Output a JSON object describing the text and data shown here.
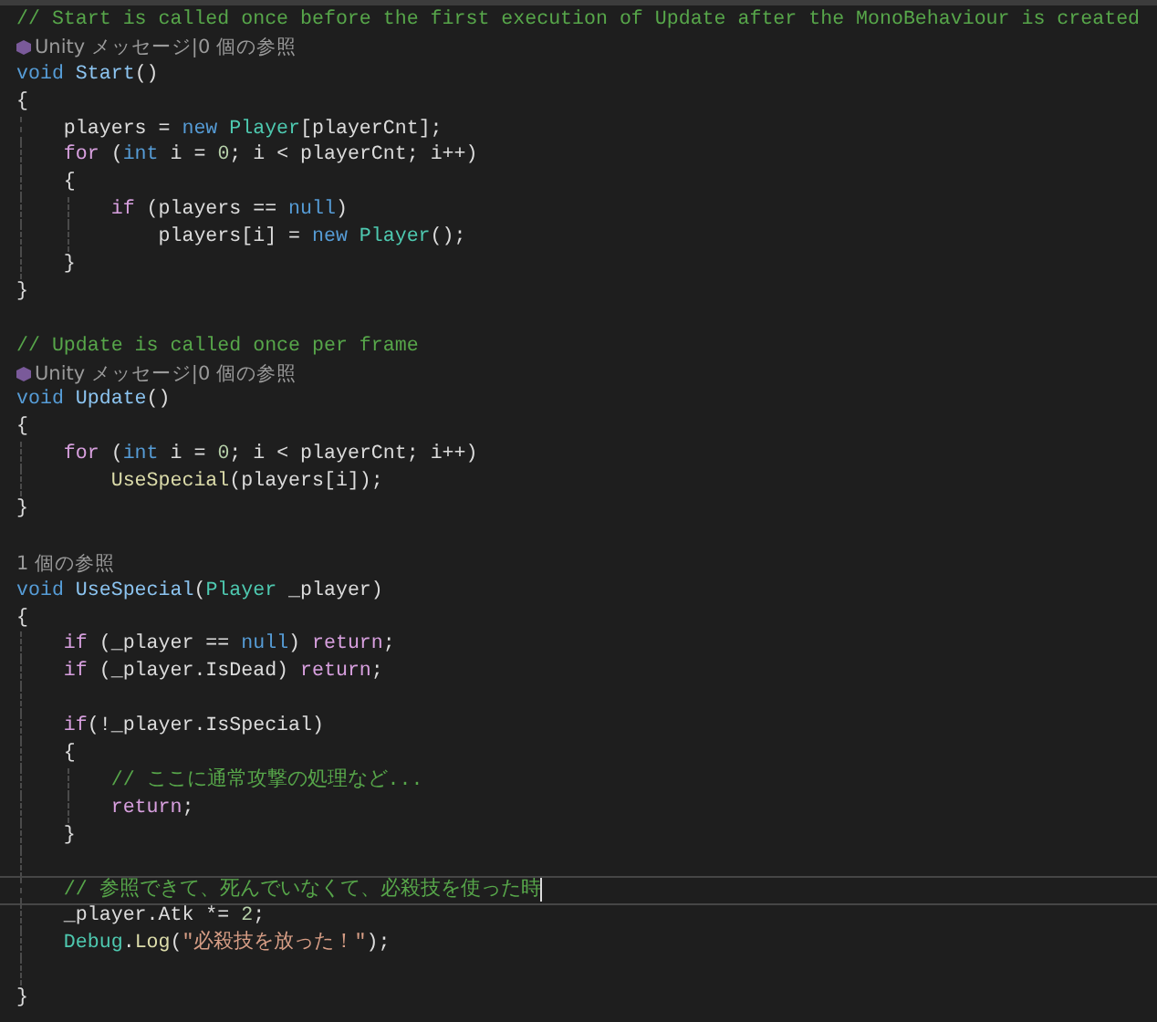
{
  "editor": {
    "lines": [
      {
        "kind": "code",
        "current": false,
        "tokens": [
          {
            "kind": "comment",
            "text": "// Start is called once before the first execution of Update after the MonoBehaviour is created"
          }
        ]
      },
      {
        "kind": "codelens",
        "icon": true,
        "text": "Unity メッセージ|0 個の参照"
      },
      {
        "kind": "code",
        "current": false,
        "tokens": [
          {
            "kind": "keyword",
            "text": "void "
          },
          {
            "kind": "decl",
            "text": "Start"
          },
          {
            "kind": "plain",
            "text": "()"
          }
        ]
      },
      {
        "kind": "code",
        "current": false,
        "tokens": [
          {
            "kind": "plain",
            "text": "{"
          }
        ]
      },
      {
        "kind": "code",
        "current": false,
        "tokens": [
          {
            "kind": "plain",
            "text": "    players = "
          },
          {
            "kind": "keyword",
            "text": "new "
          },
          {
            "kind": "class",
            "text": "Player"
          },
          {
            "kind": "plain",
            "text": "[playerCnt];"
          }
        ]
      },
      {
        "kind": "code",
        "current": false,
        "tokens": [
          {
            "kind": "control",
            "text": "    for"
          },
          {
            "kind": "plain",
            "text": " ("
          },
          {
            "kind": "keyword",
            "text": "int"
          },
          {
            "kind": "plain",
            "text": " i = "
          },
          {
            "kind": "number",
            "text": "0"
          },
          {
            "kind": "plain",
            "text": "; i < playerCnt; i++)"
          }
        ]
      },
      {
        "kind": "code",
        "current": false,
        "tokens": [
          {
            "kind": "plain",
            "text": "    {"
          }
        ]
      },
      {
        "kind": "code",
        "current": false,
        "tokens": [
          {
            "kind": "control",
            "text": "        if"
          },
          {
            "kind": "plain",
            "text": " (players == "
          },
          {
            "kind": "keyword",
            "text": "null"
          },
          {
            "kind": "plain",
            "text": ")"
          }
        ]
      },
      {
        "kind": "code",
        "current": false,
        "tokens": [
          {
            "kind": "plain",
            "text": "            players[i] = "
          },
          {
            "kind": "keyword",
            "text": "new "
          },
          {
            "kind": "class",
            "text": "Player"
          },
          {
            "kind": "plain",
            "text": "();"
          }
        ]
      },
      {
        "kind": "code",
        "current": false,
        "tokens": [
          {
            "kind": "plain",
            "text": "    }"
          }
        ]
      },
      {
        "kind": "code",
        "current": false,
        "tokens": [
          {
            "kind": "plain",
            "text": "}"
          }
        ]
      },
      {
        "kind": "blank",
        "current": false
      },
      {
        "kind": "code",
        "current": false,
        "tokens": [
          {
            "kind": "comment",
            "text": "// Update is called once per frame"
          }
        ]
      },
      {
        "kind": "codelens",
        "icon": true,
        "text": "Unity メッセージ|0 個の参照"
      },
      {
        "kind": "code",
        "current": false,
        "tokens": [
          {
            "kind": "keyword",
            "text": "void "
          },
          {
            "kind": "decl",
            "text": "Update"
          },
          {
            "kind": "plain",
            "text": "()"
          }
        ]
      },
      {
        "kind": "code",
        "current": false,
        "tokens": [
          {
            "kind": "plain",
            "text": "{"
          }
        ]
      },
      {
        "kind": "code",
        "current": false,
        "tokens": [
          {
            "kind": "control",
            "text": "    for"
          },
          {
            "kind": "plain",
            "text": " ("
          },
          {
            "kind": "keyword",
            "text": "int"
          },
          {
            "kind": "plain",
            "text": " i = "
          },
          {
            "kind": "number",
            "text": "0"
          },
          {
            "kind": "plain",
            "text": "; i < playerCnt; i++)"
          }
        ]
      },
      {
        "kind": "code",
        "current": false,
        "tokens": [
          {
            "kind": "method",
            "text": "        UseSpecial"
          },
          {
            "kind": "plain",
            "text": "(players[i]);"
          }
        ]
      },
      {
        "kind": "code",
        "current": false,
        "tokens": [
          {
            "kind": "plain",
            "text": "}"
          }
        ]
      },
      {
        "kind": "blank",
        "current": false
      },
      {
        "kind": "codelens",
        "icon": false,
        "text": "1 個の参照"
      },
      {
        "kind": "code",
        "current": false,
        "tokens": [
          {
            "kind": "keyword",
            "text": "void "
          },
          {
            "kind": "decl",
            "text": "UseSpecial"
          },
          {
            "kind": "plain",
            "text": "("
          },
          {
            "kind": "class",
            "text": "Player"
          },
          {
            "kind": "plain",
            "text": " _player)"
          }
        ]
      },
      {
        "kind": "code",
        "current": false,
        "tokens": [
          {
            "kind": "plain",
            "text": "{"
          }
        ]
      },
      {
        "kind": "code",
        "current": false,
        "tokens": [
          {
            "kind": "control",
            "text": "    if"
          },
          {
            "kind": "plain",
            "text": " (_player == "
          },
          {
            "kind": "keyword",
            "text": "null"
          },
          {
            "kind": "plain",
            "text": ") "
          },
          {
            "kind": "control",
            "text": "return"
          },
          {
            "kind": "plain",
            "text": ";"
          }
        ]
      },
      {
        "kind": "code",
        "current": false,
        "tokens": [
          {
            "kind": "control",
            "text": "    if"
          },
          {
            "kind": "plain",
            "text": " (_player.IsDead) "
          },
          {
            "kind": "control",
            "text": "return"
          },
          {
            "kind": "plain",
            "text": ";"
          }
        ]
      },
      {
        "kind": "blank",
        "current": false
      },
      {
        "kind": "code",
        "current": false,
        "tokens": [
          {
            "kind": "control",
            "text": "    if"
          },
          {
            "kind": "plain",
            "text": "(!_player.IsSpecial)"
          }
        ]
      },
      {
        "kind": "code",
        "current": false,
        "tokens": [
          {
            "kind": "plain",
            "text": "    {"
          }
        ]
      },
      {
        "kind": "code",
        "current": false,
        "tokens": [
          {
            "kind": "comment",
            "text": "        // ここに通常攻撃の処理など..."
          }
        ]
      },
      {
        "kind": "code",
        "current": false,
        "tokens": [
          {
            "kind": "control",
            "text": "        return"
          },
          {
            "kind": "plain",
            "text": ";"
          }
        ]
      },
      {
        "kind": "code",
        "current": false,
        "tokens": [
          {
            "kind": "plain",
            "text": "    }"
          }
        ]
      },
      {
        "kind": "blank",
        "current": false
      },
      {
        "kind": "code",
        "current": true,
        "tokens": [
          {
            "kind": "comment",
            "text": "    // 参照できて、死んでいなくて、必殺技を使った時"
          }
        ]
      },
      {
        "kind": "code",
        "current": false,
        "tokens": [
          {
            "kind": "plain",
            "text": "    _player.Atk *= "
          },
          {
            "kind": "number",
            "text": "2"
          },
          {
            "kind": "plain",
            "text": ";"
          }
        ]
      },
      {
        "kind": "code",
        "current": false,
        "tokens": [
          {
            "kind": "class",
            "text": "    Debug"
          },
          {
            "kind": "plain",
            "text": "."
          },
          {
            "kind": "method",
            "text": "Log"
          },
          {
            "kind": "plain",
            "text": "("
          },
          {
            "kind": "string",
            "text": "\"必殺技を放った！\""
          },
          {
            "kind": "plain",
            "text": ");"
          }
        ]
      },
      {
        "kind": "blank",
        "current": false
      },
      {
        "kind": "code",
        "current": false,
        "tokens": [
          {
            "kind": "plain",
            "text": "}"
          }
        ]
      }
    ]
  }
}
